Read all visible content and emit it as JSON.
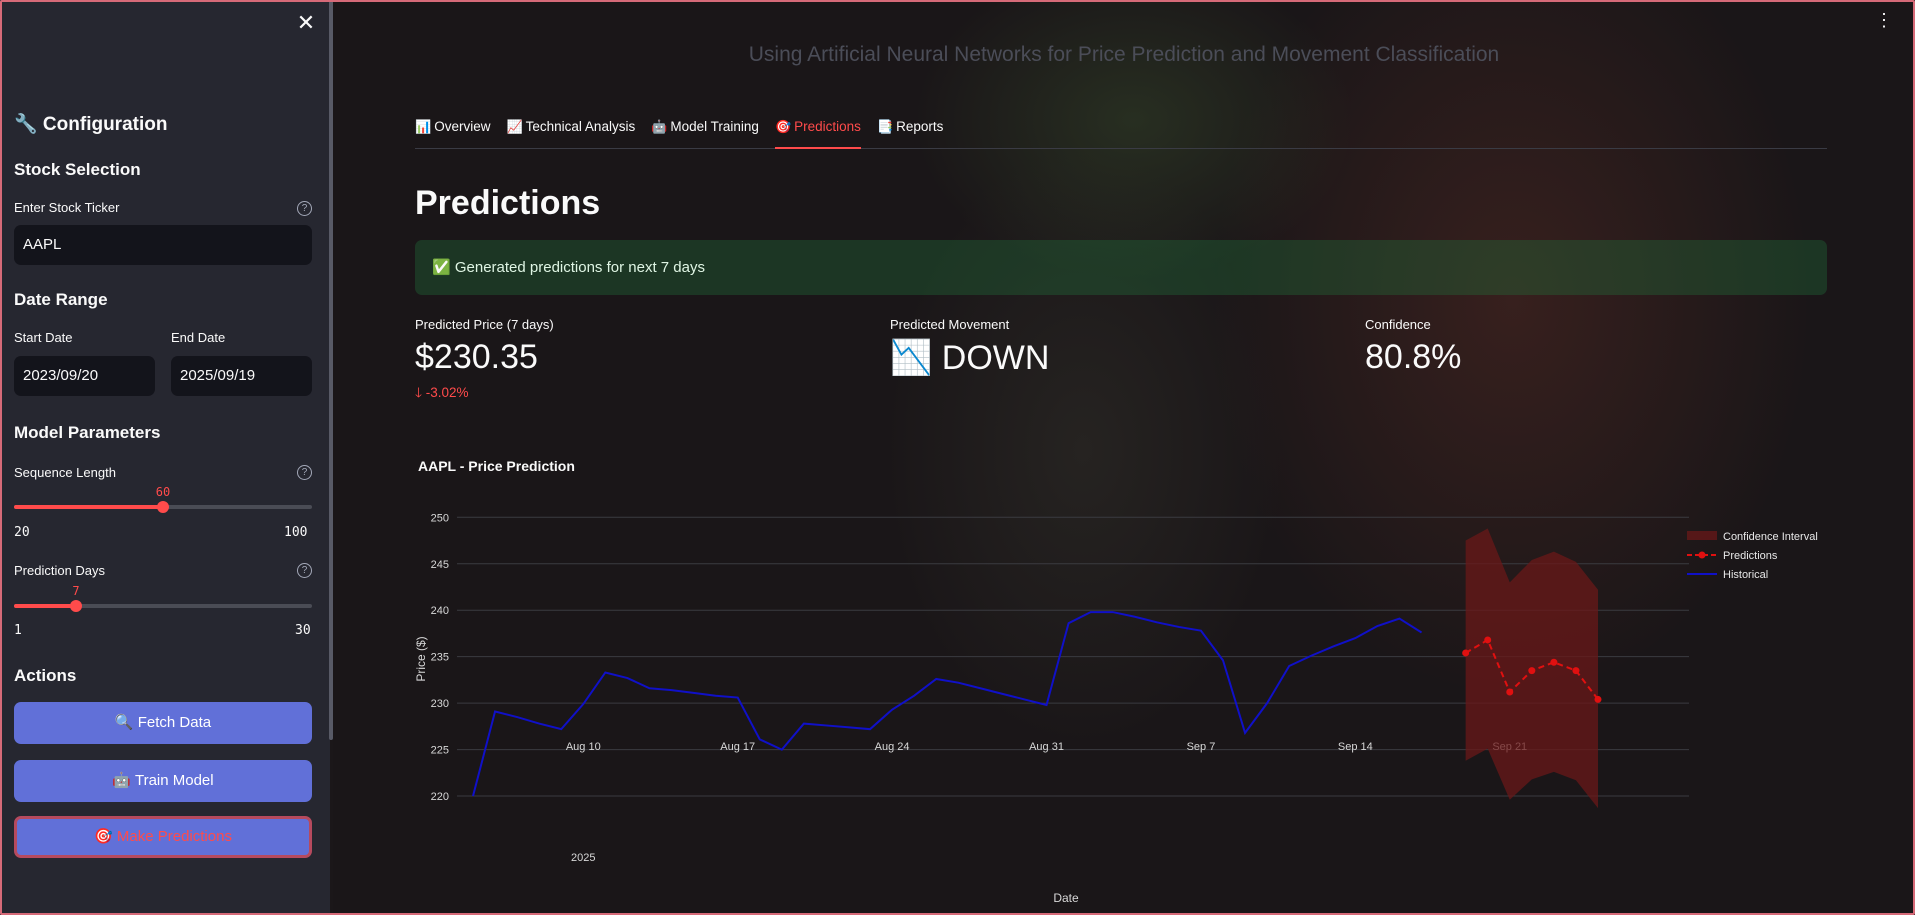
{
  "sidebar": {
    "title": "🔧 Configuration",
    "stock_section": "Stock Selection",
    "ticker_label": "Enter Stock Ticker",
    "ticker_value": "AAPL",
    "date_section": "Date Range",
    "start_label": "Start Date",
    "start_value": "2023/09/20",
    "end_label": "End Date",
    "end_value": "2025/09/19",
    "model_section": "Model Parameters",
    "seq_label": "Sequence Length",
    "seq_value": "60",
    "seq_min": "20",
    "seq_max": "100",
    "seq_fraction": 0.5,
    "days_label": "Prediction Days",
    "days_value": "7",
    "days_min": "1",
    "days_max": "30",
    "days_fraction": 0.207,
    "actions_section": "Actions",
    "fetch_label": "🔍 Fetch Data",
    "train_label": "🤖 Train Model",
    "predict_label": "🎯 Make Predictions"
  },
  "header": {
    "subtitle": "Using Artificial Neural Networks for Price Prediction and Movement Classification"
  },
  "tabs": [
    {
      "icon": "📊",
      "label": "Overview"
    },
    {
      "icon": "📈",
      "label": "Technical Analysis"
    },
    {
      "icon": "🤖",
      "label": "Model Training"
    },
    {
      "icon": "🎯",
      "label": "Predictions"
    },
    {
      "icon": "📑",
      "label": "Reports"
    }
  ],
  "main": {
    "title": "Predictions",
    "success": "✅ Generated predictions for next 7 days",
    "metrics": [
      {
        "label": "Predicted Price (7 days)",
        "value": "$230.35",
        "delta": "-3.02%"
      },
      {
        "label": "Predicted Movement",
        "value": "📉 DOWN"
      },
      {
        "label": "Confidence",
        "value": "80.8%"
      }
    ]
  },
  "colors": {
    "accent": "#ff4b4b",
    "button": "#6170d8",
    "historical": "#1010c8",
    "predictions": "#e01010",
    "confidence": "#6a1818"
  },
  "chart_data": {
    "type": "line",
    "title": "AAPL - Price Prediction",
    "xlabel": "Date",
    "ylabel": "Price ($)",
    "ylim": [
      218.5,
      251
    ],
    "yticks": [
      220,
      225,
      230,
      235,
      240,
      245,
      250
    ],
    "xticks": [
      {
        "date": "2025-08-10",
        "label": "Aug 10",
        "sub": "2025"
      },
      {
        "date": "2025-08-17",
        "label": "Aug 17"
      },
      {
        "date": "2025-08-24",
        "label": "Aug 24"
      },
      {
        "date": "2025-08-31",
        "label": "Aug 31"
      },
      {
        "date": "2025-09-07",
        "label": "Sep 7"
      },
      {
        "date": "2025-09-14",
        "label": "Sep 14"
      },
      {
        "date": "2025-09-21",
        "label": "Sep 21"
      }
    ],
    "legend": [
      "Confidence Interval",
      "Predictions",
      "Historical"
    ],
    "series": [
      {
        "name": "Historical",
        "x": [
          "2025-08-05",
          "2025-08-06",
          "2025-08-07",
          "2025-08-08",
          "2025-08-09",
          "2025-08-10",
          "2025-08-11",
          "2025-08-12",
          "2025-08-13",
          "2025-08-14",
          "2025-08-15",
          "2025-08-16",
          "2025-08-17",
          "2025-08-18",
          "2025-08-19",
          "2025-08-20",
          "2025-08-21",
          "2025-08-22",
          "2025-08-23",
          "2025-08-24",
          "2025-08-25",
          "2025-08-26",
          "2025-08-27",
          "2025-08-28",
          "2025-08-29",
          "2025-08-30",
          "2025-08-31",
          "2025-09-01",
          "2025-09-02",
          "2025-09-03",
          "2025-09-04",
          "2025-09-05",
          "2025-09-06",
          "2025-09-07",
          "2025-09-08",
          "2025-09-09",
          "2025-09-10",
          "2025-09-11",
          "2025-09-12",
          "2025-09-13",
          "2025-09-14",
          "2025-09-15",
          "2025-09-16",
          "2025-09-17",
          "2025-09-18"
        ],
        "values": [
          220.0,
          229.1,
          228.5,
          227.8,
          227.2,
          229.9,
          233.3,
          232.7,
          231.6,
          231.4,
          231.1,
          230.8,
          230.6,
          226.1,
          225.0,
          227.8,
          227.6,
          227.4,
          227.2,
          229.3,
          230.8,
          232.6,
          232.2,
          231.6,
          231.0,
          230.4,
          229.8,
          238.6,
          239.8,
          239.8,
          239.3,
          238.7,
          238.2,
          237.8,
          234.6,
          226.8,
          230.0,
          234.0,
          235.1,
          236.1,
          237.0,
          238.3,
          239.1,
          237.6,
          null
        ]
      },
      {
        "name": "Predictions",
        "x": [
          "2025-09-19",
          "2025-09-20",
          "2025-09-21",
          "2025-09-22",
          "2025-09-23",
          "2025-09-24",
          "2025-09-25"
        ],
        "values": [
          235.4,
          236.8,
          231.2,
          233.5,
          234.4,
          233.5,
          230.4
        ]
      },
      {
        "name": "Confidence Interval",
        "x": [
          "2025-09-19",
          "2025-09-20",
          "2025-09-21",
          "2025-09-22",
          "2025-09-23",
          "2025-09-24",
          "2025-09-25"
        ],
        "upper": [
          247.5,
          248.8,
          243.0,
          245.4,
          246.3,
          245.2,
          242.2
        ],
        "lower": [
          223.8,
          225.1,
          219.6,
          221.8,
          222.6,
          221.7,
          218.7
        ]
      }
    ]
  }
}
